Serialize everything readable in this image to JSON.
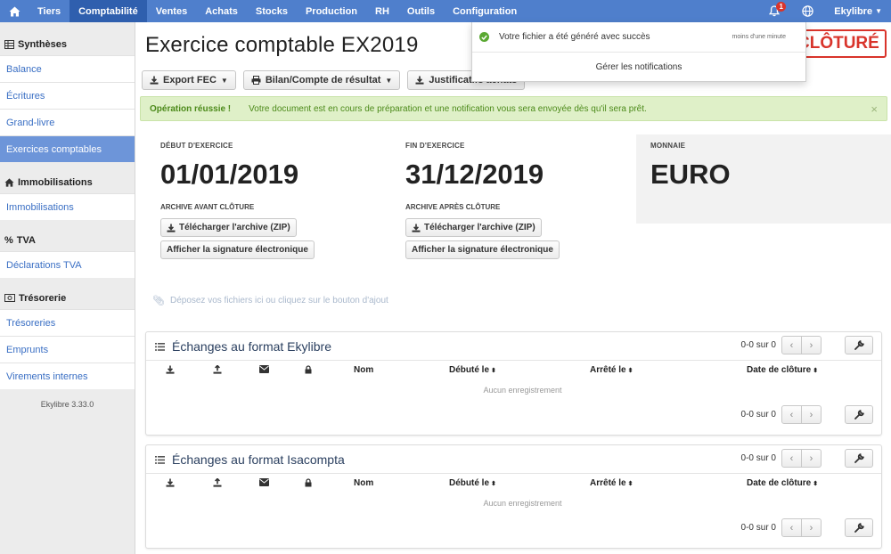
{
  "nav": {
    "items": [
      "Tiers",
      "Comptabilité",
      "Ventes",
      "Achats",
      "Stocks",
      "Production",
      "RH",
      "Outils",
      "Configuration"
    ],
    "active": "Comptabilité",
    "notification_count": "1",
    "user": "Ekylibre"
  },
  "sidebar": {
    "sections": [
      {
        "title": "Synthèses",
        "icon": "table-icon",
        "items": [
          "Balance",
          "Écritures",
          "Grand-livre",
          "Exercices comptables"
        ]
      },
      {
        "title": "Immobilisations",
        "icon": "home-icon",
        "items": [
          "Immobilisations"
        ]
      },
      {
        "title": "TVA",
        "icon": "percent-icon",
        "items": [
          "Déclarations TVA"
        ]
      },
      {
        "title": "Trésorerie",
        "icon": "money-icon",
        "items": [
          "Trésoreries",
          "Emprunts",
          "Virements internes"
        ]
      }
    ],
    "active_item": "Exercices comptables",
    "version": "Ekylibre 3.33.0"
  },
  "page": {
    "title": "Exercice comptable EX2019",
    "close_button": "CLÔTURÉ"
  },
  "toolbar": {
    "export_fec": "Export FEC",
    "bilan": "Bilan/Compte de résultat",
    "justificatifs": "Justificatifs achats"
  },
  "alert": {
    "title": "Opération réussie !",
    "message": "Votre document est en cours de préparation et une notification vous sera envoyée dès qu'il sera prêt.",
    "close": "×"
  },
  "exercise": {
    "start_label": "DÉBUT D'EXERCICE",
    "start_value": "01/01/2019",
    "end_label": "FIN D'EXERCICE",
    "end_value": "31/12/2019",
    "currency_label": "MONNAIE",
    "currency_value": "EURO",
    "archive_before_label": "ARCHIVE AVANT CLÔTURE",
    "archive_after_label": "ARCHIVE APRÈS CLÔTURE",
    "download_zip": "Télécharger l'archive (ZIP)",
    "show_signature": "Afficher la signature électronique"
  },
  "dropzone": {
    "text": "Déposez vos fichiers ici ou cliquez sur le bouton d'ajout"
  },
  "panels": [
    {
      "title": "Échanges au format Ekylibre",
      "count": "0-0 sur 0",
      "columns": {
        "nom": "Nom",
        "debute": "Débuté le",
        "arrete": "Arrêté le",
        "cloture": "Date de clôture"
      },
      "empty": "Aucun enregistrement"
    },
    {
      "title": "Échanges au format Isacompta",
      "count": "0-0 sur 0",
      "columns": {
        "nom": "Nom",
        "debute": "Débuté le",
        "arrete": "Arrêté le",
        "cloture": "Date de clôture"
      },
      "empty": "Aucun enregistrement"
    }
  ],
  "notification": {
    "message": "Votre fichier a été généré avec succès",
    "time": "moins d'une minute",
    "manage": "Gérer les notifications"
  },
  "colors": {
    "nav": "#4f7fcc",
    "nav_active": "#2f5fae",
    "sidebar_active": "#6d95d9",
    "danger": "#d9342b",
    "success_bg": "#dff0c8",
    "success_text": "#4c8a1a"
  }
}
